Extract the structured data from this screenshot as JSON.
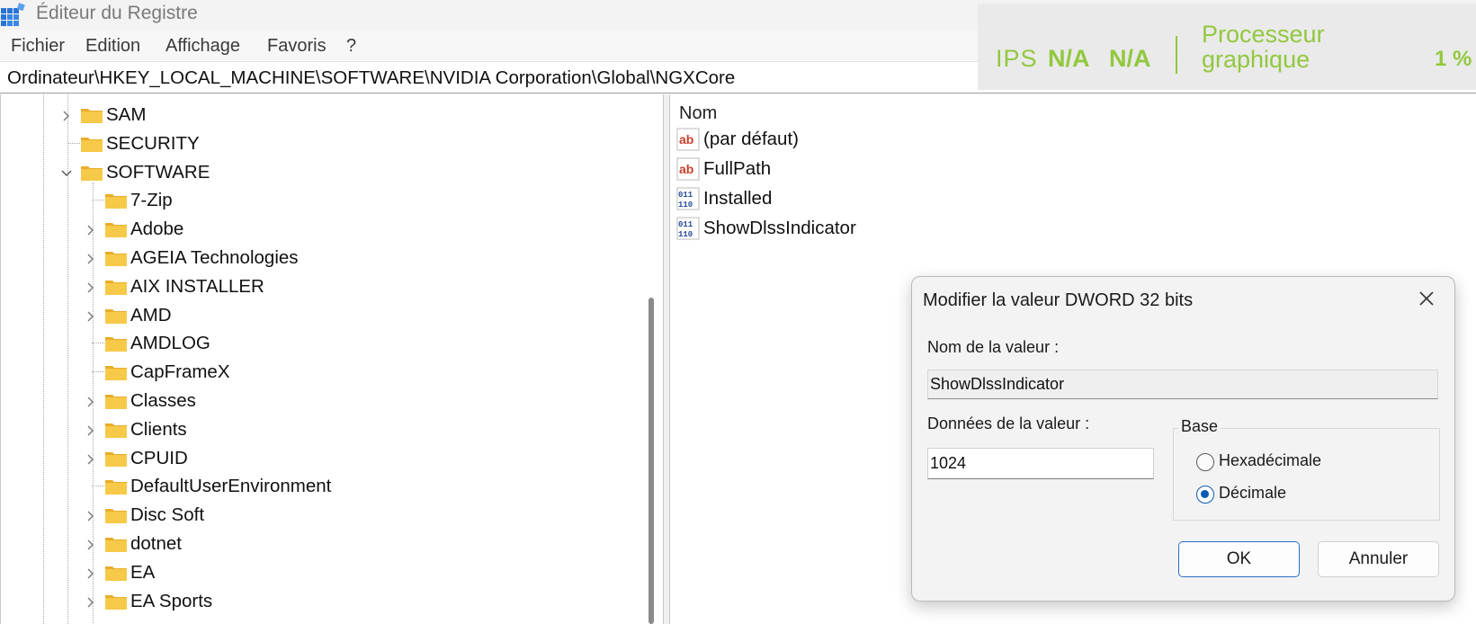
{
  "window": {
    "title": "Éditeur du Registre"
  },
  "menu": {
    "items": [
      {
        "label": "Fichier"
      },
      {
        "label": "Edition"
      },
      {
        "label": "Affichage"
      },
      {
        "label": "Favoris"
      },
      {
        "label": "?"
      }
    ]
  },
  "address": {
    "path": "Ordinateur\\HKEY_LOCAL_MACHINE\\SOFTWARE\\NVIDIA Corporation\\Global\\NGXCore"
  },
  "overlay": {
    "ips_label": "IPS",
    "ips_value": "N/A",
    "ips_value2": "N/A",
    "gpu_label": "Processeur\ngraphique",
    "gpu_value": "1 %",
    "color": "#92c83e"
  },
  "tree": {
    "items": [
      {
        "label": "SAM",
        "expander": "collapsed"
      },
      {
        "label": "SECURITY",
        "expander": "none"
      },
      {
        "label": "SOFTWARE",
        "expander": "expanded"
      },
      {
        "label": "7-Zip",
        "expander": "none"
      },
      {
        "label": "Adobe",
        "expander": "collapsed"
      },
      {
        "label": "AGEIA Technologies",
        "expander": "collapsed"
      },
      {
        "label": "AIX INSTALLER",
        "expander": "collapsed"
      },
      {
        "label": "AMD",
        "expander": "collapsed"
      },
      {
        "label": "AMDLOG",
        "expander": "none"
      },
      {
        "label": "CapFrameX",
        "expander": "none"
      },
      {
        "label": "Classes",
        "expander": "collapsed"
      },
      {
        "label": "Clients",
        "expander": "collapsed"
      },
      {
        "label": "CPUID",
        "expander": "collapsed"
      },
      {
        "label": "DefaultUserEnvironment",
        "expander": "none"
      },
      {
        "label": "Disc Soft",
        "expander": "collapsed"
      },
      {
        "label": "dotnet",
        "expander": "collapsed"
      },
      {
        "label": "EA",
        "expander": "collapsed"
      },
      {
        "label": "EA Sports",
        "expander": "collapsed"
      }
    ]
  },
  "values": {
    "column_name": "Nom",
    "items": [
      {
        "name": "(par défaut)",
        "type": "string"
      },
      {
        "name": "FullPath",
        "type": "string"
      },
      {
        "name": "Installed",
        "type": "binary"
      },
      {
        "name": "ShowDlssIndicator",
        "type": "binary"
      }
    ]
  },
  "dialog": {
    "title": "Modifier la valeur DWORD 32 bits",
    "name_label": "Nom de la valeur :",
    "name_value": "ShowDlssIndicator",
    "data_label": "Données de la valeur :",
    "data_value": "1024",
    "base_label": "Base",
    "radio_hex": "Hexadécimale",
    "radio_dec": "Décimale",
    "selected_base": "Décimale",
    "ok_label": "OK",
    "cancel_label": "Annuler"
  },
  "colors": {
    "folder": "#f7c948",
    "accent": "#0a5bb5",
    "gpu_overlay": "#92c83e"
  }
}
